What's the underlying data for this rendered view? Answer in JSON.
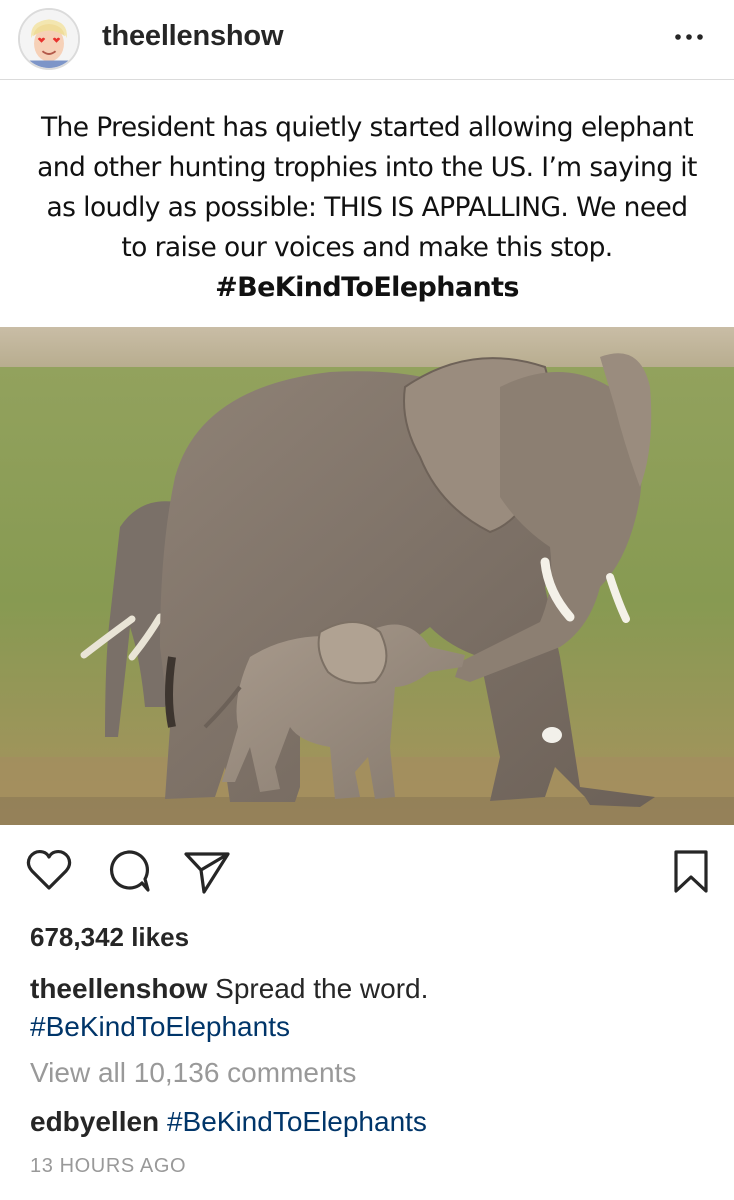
{
  "post": {
    "username": "theellenshow",
    "more_icon": "ellipsis-icon",
    "avatar_icon": "heart-eyes-avatar-icon",
    "image_text": {
      "line1": "The President has quietly started allowing elephant",
      "line2": "and other hunting trophies into the US. I’m saying it",
      "line3": "as loudly as possible: THIS IS APPALLING. We need",
      "line4": "to raise our voices and make this stop.",
      "hashtag": "#BeKindToElephants"
    },
    "likes": "678,342 likes",
    "caption": {
      "username": "theellenshow",
      "text": "Spread the word.",
      "hashtag": "#BeKindToElephants"
    },
    "view_all_comments": "View all 10,136 comments",
    "comment": {
      "username": "edbyellen",
      "text": "#BeKindToElephants"
    },
    "timestamp": "13 HOURS AGO"
  },
  "actions": {
    "like": "heart-icon",
    "comment": "comment-bubble-icon",
    "share": "paper-plane-icon",
    "save": "bookmark-icon"
  },
  "colors": {
    "text": "#262626",
    "muted": "#999999",
    "hashtag": "#003569",
    "divider": "#dbdbdb"
  }
}
